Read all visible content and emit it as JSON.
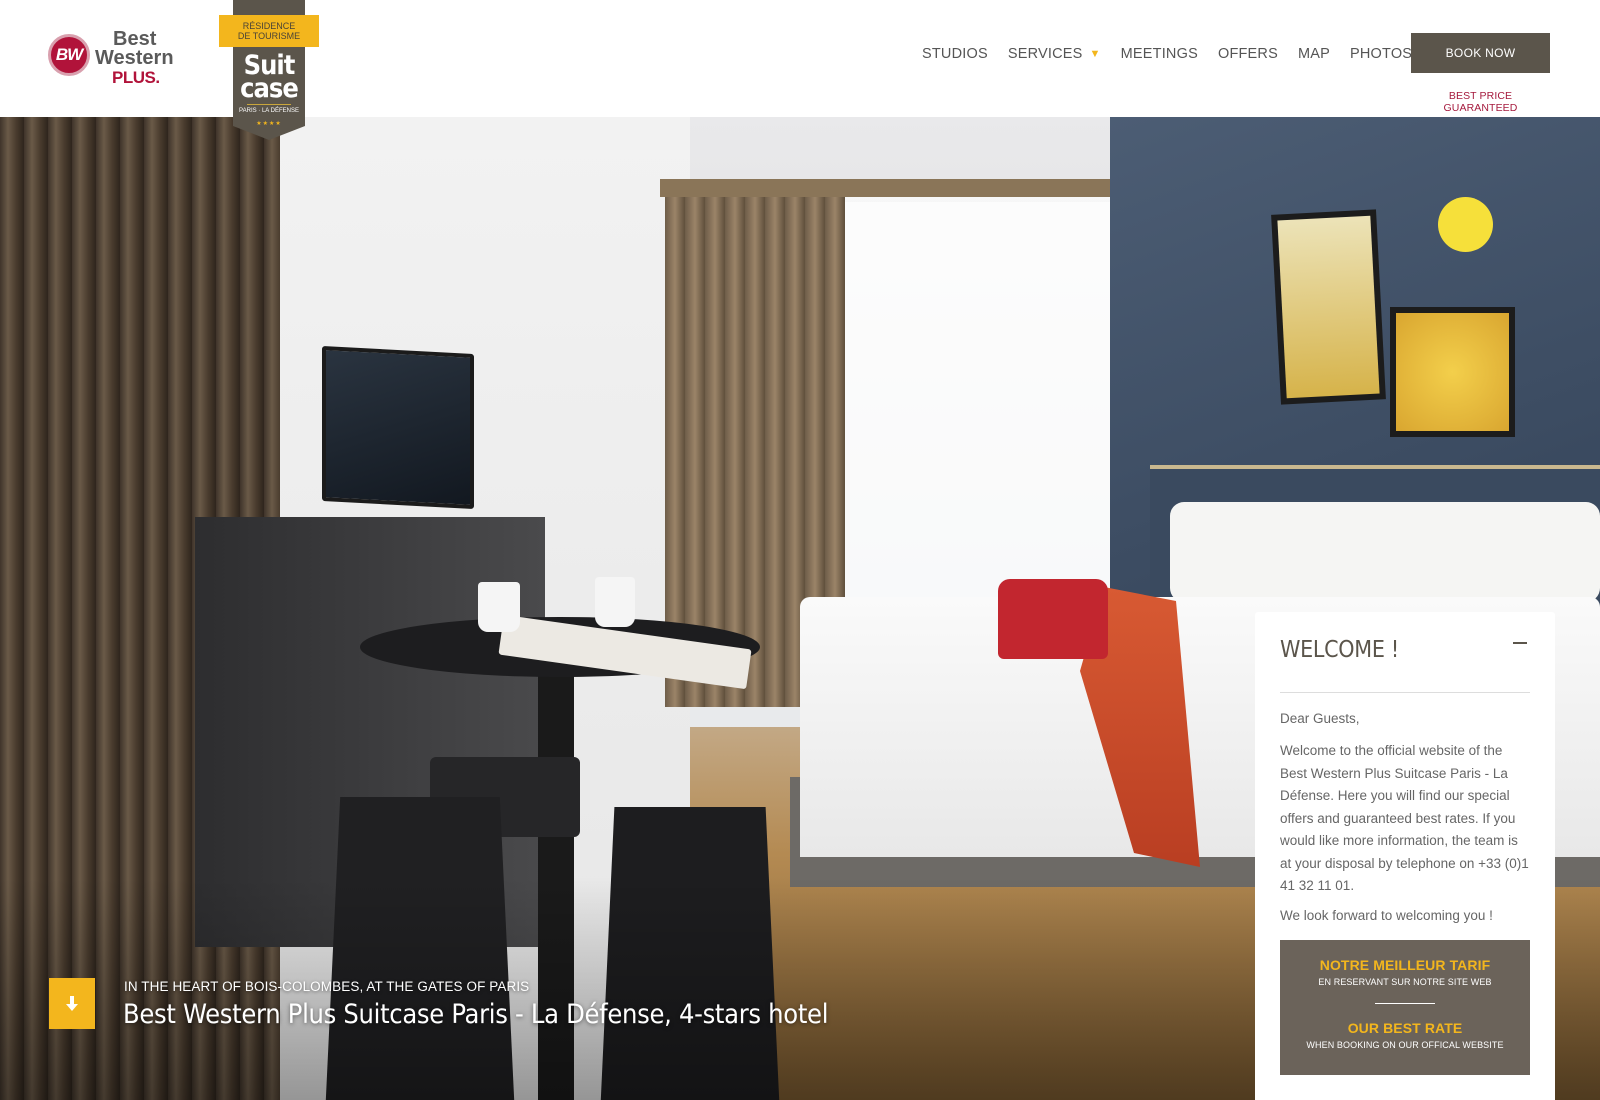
{
  "header": {
    "logo": {
      "brand": "Best Western",
      "line1": "Best",
      "line2": "Western",
      "line3": "PLUS.",
      "mark": "BW",
      "brand_color": "#b1133a"
    },
    "badge": {
      "top_line1": "RÉSIDENCE",
      "top_line2": "DE TOURISME",
      "word1": "Suit",
      "word2": "case",
      "location": "PARIS · LA DÉFENSE",
      "stars": "★★★★",
      "accent": "#f3b61d",
      "body_color": "#5b554b"
    },
    "nav": [
      {
        "label": "STUDIOS"
      },
      {
        "label": "SERVICES"
      },
      {
        "label": "MEETINGS"
      },
      {
        "label": "OFFERS"
      },
      {
        "label": "MAP"
      },
      {
        "label": "PHOTOS"
      }
    ],
    "services_caret": "▼",
    "book_button": "BOOK NOW",
    "best_price": "BEST PRICE GUARANTEED"
  },
  "hero": {
    "subtitle": "IN THE HEART OF BOIS-COLOMBES, AT THE GATES OF PARIS",
    "title": "Best Western Plus Suitcase Paris - La Défense, 4-stars hotel",
    "scroll_icon": "arrow-down-icon",
    "scroll_glyph": "🡇"
  },
  "welcome": {
    "title": "WELCOME !",
    "greeting": "Dear Guests,",
    "body": "Welcome to the official website of the Best Western Plus Suitcase Paris - La Défense. Here you will find our special offers and guaranteed best rates. If you would like more information, the team is at your disposal by telephone on +33 (0)1 41 32 11 01.",
    "closing": "We look forward to welcoming you !",
    "rate_fr_title": "NOTRE MEILLEUR TARIF",
    "rate_fr_sub": "EN RESERVANT SUR NOTRE SITE WEB",
    "rate_en_title": "OUR BEST RATE",
    "rate_en_sub": "WHEN BOOKING ON OUR OFFICAL WEBSITE"
  }
}
